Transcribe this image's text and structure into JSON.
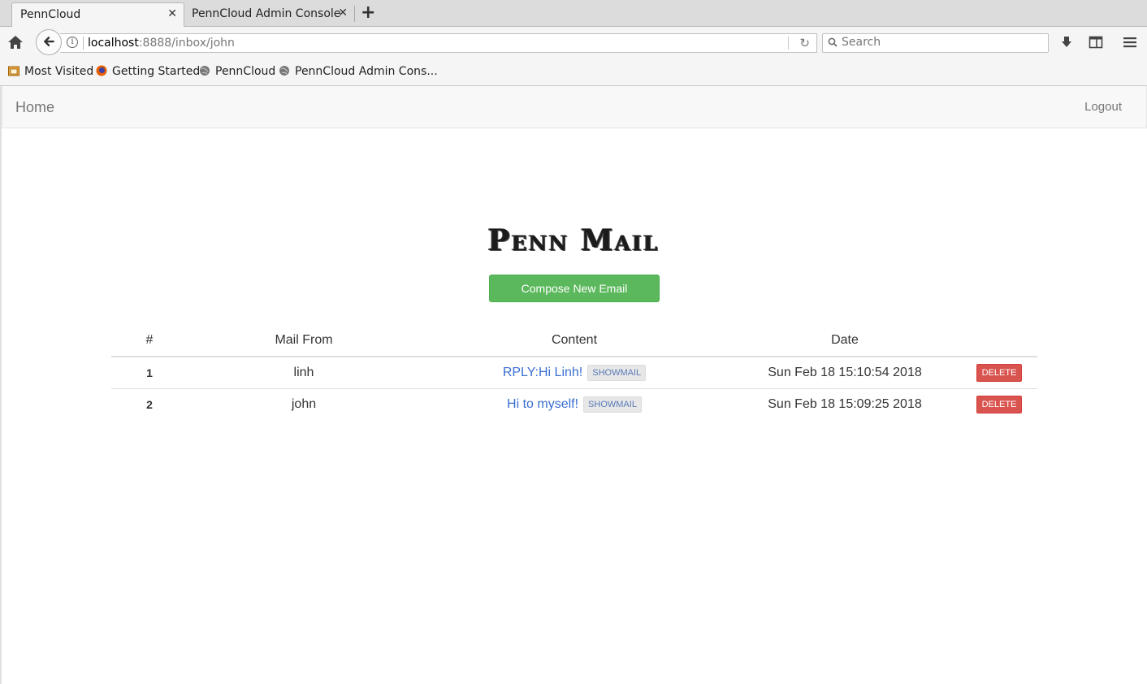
{
  "browser": {
    "tabs": [
      {
        "label": "PennCloud"
      },
      {
        "label": "PennCloud Admin Console"
      }
    ],
    "url": {
      "host": "localhost",
      "rest": ":8888/inbox/john"
    },
    "search": {
      "placeholder": "Search"
    },
    "bookmarks": [
      {
        "label": "Most Visited"
      },
      {
        "label": "Getting Started"
      },
      {
        "label": "PennCloud"
      },
      {
        "label": "PennCloud Admin Cons..."
      }
    ]
  },
  "site_nav": {
    "home": "Home",
    "logout": "Logout"
  },
  "page": {
    "title": "Penn Mail",
    "compose_label": "Compose New Email"
  },
  "table": {
    "headers": {
      "num": "#",
      "from": "Mail From",
      "content": "Content",
      "date": "Date"
    },
    "rows": [
      {
        "num": "1",
        "from": "linh",
        "subject": "RPLY:Hi Linh!",
        "show": "SHOWMAIL",
        "date": "Sun Feb 18 15:10:54 2018",
        "delete": "DELETE"
      },
      {
        "num": "2",
        "from": "john",
        "subject": "Hi to myself!",
        "show": "SHOWMAIL",
        "date": "Sun Feb 18 15:09:25 2018",
        "delete": "DELETE"
      }
    ]
  },
  "colors": {
    "compose": "#5cb85c",
    "delete": "#d9534f",
    "link": "#3a6fd0"
  }
}
